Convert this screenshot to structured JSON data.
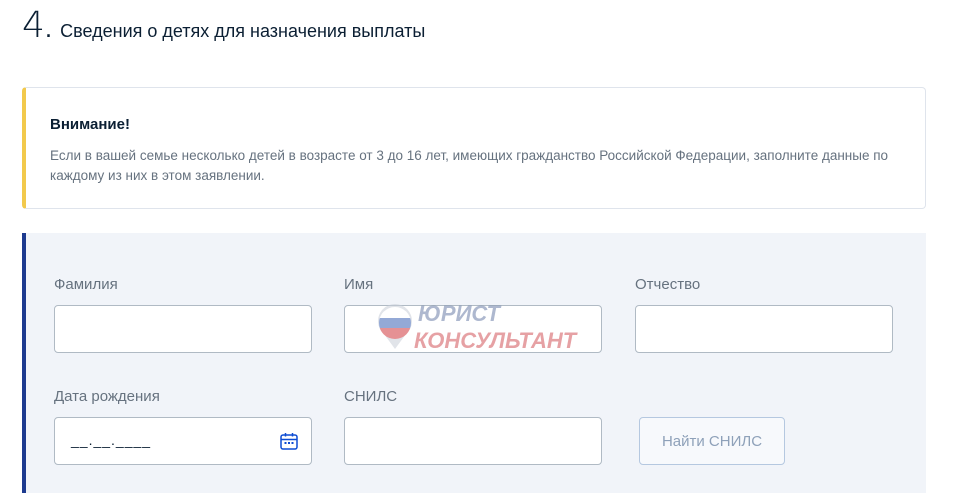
{
  "section": {
    "number": "4",
    "dot": ".",
    "title": "Сведения о детях для назначения выплаты"
  },
  "alert": {
    "title": "Внимание!",
    "text": "Если в вашей семье несколько детей в возрасте от 3 до 16 лет, имеющих гражданство Российской Федерации, заполните данные по каждому из них в этом заявлении.",
    "accent_color": "#f2c94c"
  },
  "form": {
    "accent_color": "#1d3a8f",
    "fields": {
      "last_name": {
        "label": "Фамилия",
        "value": ""
      },
      "first_name": {
        "label": "Имя",
        "value": ""
      },
      "patronymic": {
        "label": "Отчество",
        "value": ""
      },
      "birth_date": {
        "label": "Дата рождения",
        "placeholder": "__.__.____",
        "icon": "calendar-icon"
      },
      "snils": {
        "label": "СНИЛС",
        "value": ""
      }
    },
    "find_snils_button": "Найти СНИЛС"
  },
  "watermark": {
    "line1": "ЮРИСТ",
    "line2": "КОНСУЛЬТАНТ"
  }
}
